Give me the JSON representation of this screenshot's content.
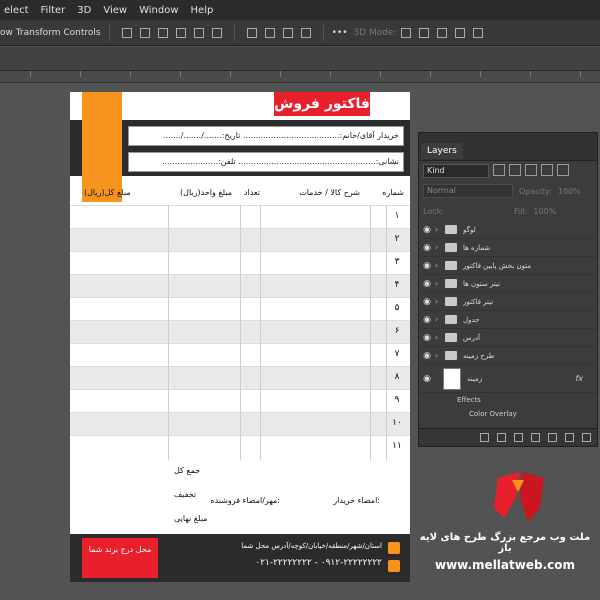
{
  "menu": [
    "elect",
    "Filter",
    "3D",
    "View",
    "Window",
    "Help"
  ],
  "options_bar": {
    "transform_label": "ow Transform Controls",
    "mode_label": "3D Mode:"
  },
  "invoice": {
    "title": "فاکتور فروش",
    "buyer_line": "خریدار آقای/خانم:...................................... تاریخ:......./......./.......",
    "address_line": "نشانی:...................................................... تلفن:......................",
    "columns": [
      "شماره",
      "شرح کالا / خدمات",
      "تعداد",
      "مبلغ واحد(ریال)",
      "مبلغ کل(ریال)"
    ],
    "rows": [
      "۱",
      "۲",
      "۳",
      "۴",
      "۵",
      "۶",
      "۷",
      "۸",
      "۹",
      "۱۰",
      "۱۱"
    ],
    "totals": {
      "sum": "جمع کل",
      "discount": "تخفیف",
      "final": "مبلغ نهایی"
    },
    "sign_buyer": "امضاء خریدار:",
    "sign_seller": "مهر/امضاء فروشنده:",
    "brand_box": "محل درج برند شما",
    "address": "استان/شهر/منطقه/خیابان/کوچه/آدرس محل شما",
    "phones": "۰۲۱-۲۲۲۲۲۲۲۲ - ۰۹۱۲-۲۲۲۲۲۲۲۲"
  },
  "layers_panel": {
    "tab": "Layers",
    "filter_kind": "Kind",
    "blend_mode": "Normal",
    "opacity_label": "Opacity:",
    "opacity_value": "100%",
    "lock_label": "Lock:",
    "fill_label": "Fill:",
    "fill_value": "100%",
    "layers": [
      "لوگو",
      "شماره ها",
      "متون بخش پایین فاکتور",
      "تیتر ستون ها",
      "تیتر فاکتور",
      "جدول",
      "آدرس",
      "طرح زمینه"
    ],
    "background_layer": "زمینه",
    "fx_label": "fx",
    "effects_label": "Effects",
    "effect_item": "Color Overlay"
  },
  "watermark": {
    "line1": "ملت وب مرجع بزرگ طرح های لایه باز",
    "line2": "www.mellatweb.com"
  },
  "colors": {
    "accent_red": "#e8202c",
    "accent_orange": "#f7941d",
    "dark_band": "#2b2b2b"
  }
}
